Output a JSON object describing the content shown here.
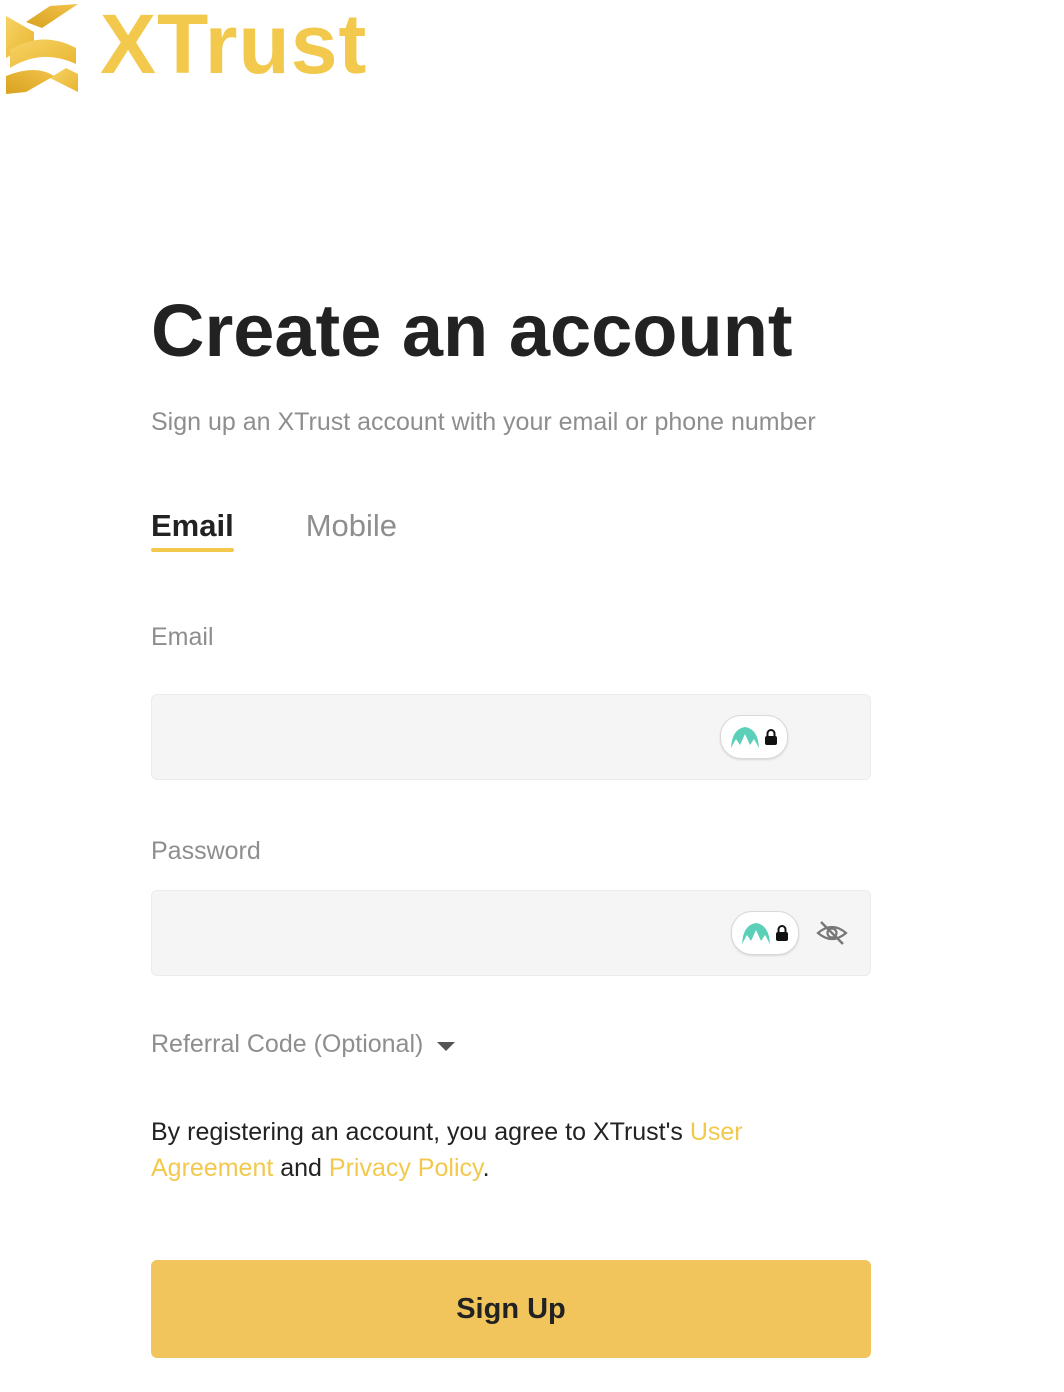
{
  "brand": {
    "name": "XTrust",
    "color": "#f2c94c"
  },
  "heading": {
    "title": "Create an account",
    "subtitle": "Sign up an XTrust account with your email or phone number"
  },
  "tabs": [
    {
      "label": "Email",
      "active": true
    },
    {
      "label": "Mobile",
      "active": false
    }
  ],
  "fields": {
    "email": {
      "label": "Email",
      "value": "",
      "placeholder": ""
    },
    "password": {
      "label": "Password",
      "value": "",
      "placeholder": ""
    }
  },
  "referral": {
    "label": "Referral Code (Optional)"
  },
  "terms": {
    "prefix": "By registering an account, you agree to XTrust's ",
    "user_agreement": "User Agreement",
    "conjunction": " and ",
    "privacy_policy": "Privacy Policy",
    "suffix": "."
  },
  "submit": {
    "label": "Sign Up",
    "color": "#f2c55c"
  },
  "icons": {
    "password_manager": "password-manager-icon",
    "visibility_toggle": "eye-slash-icon",
    "dropdown": "caret-down-icon"
  }
}
